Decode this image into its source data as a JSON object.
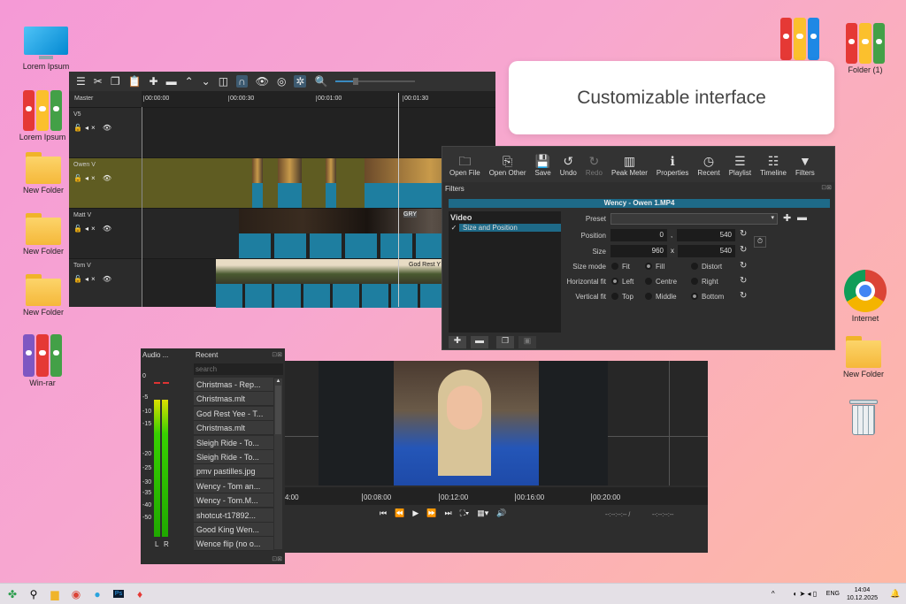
{
  "desktop": {
    "left_icons": [
      {
        "label": "Lorem Ipsum",
        "icon": "monitor-icon"
      },
      {
        "label": "Lorem Ipsum",
        "icon": "binders-icon"
      },
      {
        "label": "New Folder",
        "icon": "folder-icon"
      },
      {
        "label": "New Folder",
        "icon": "folder-icon"
      },
      {
        "label": "New Folder",
        "icon": "folder-icon"
      },
      {
        "label": "Win-rar",
        "icon": "winrar-icon"
      }
    ],
    "right_icons": [
      {
        "label": "Folder (1)",
        "icon": "binders-icon"
      },
      {
        "label": "Internet",
        "icon": "chrome-icon"
      },
      {
        "label": "New Folder",
        "icon": "folder-icon"
      }
    ],
    "card_title": "Customizable interface"
  },
  "timeline": {
    "master": "Master",
    "ruler": [
      "00:00:00",
      "00:00:30",
      "00:01:00",
      "00:01:30"
    ],
    "tracks": [
      {
        "name": "V5"
      },
      {
        "name": "Owen V"
      },
      {
        "name": "Matt V"
      },
      {
        "name": "Tom V"
      }
    ],
    "clip_titles": {
      "matt": "GRY",
      "tom": "God Rest Y"
    }
  },
  "toolbar": {
    "buttons": [
      {
        "label": "Open File",
        "icon": "folder-open-icon"
      },
      {
        "label": "Open Other",
        "icon": "open-other-icon"
      },
      {
        "label": "Save",
        "icon": "save-icon"
      },
      {
        "label": "Undo",
        "icon": "undo-icon"
      },
      {
        "label": "Redo",
        "icon": "redo-icon"
      },
      {
        "label": "Peak Meter",
        "icon": "peak-meter-icon"
      },
      {
        "label": "Properties",
        "icon": "info-icon"
      },
      {
        "label": "Recent",
        "icon": "clock-icon"
      },
      {
        "label": "Playlist",
        "icon": "list-icon"
      },
      {
        "label": "Timeline",
        "icon": "timeline-icon"
      },
      {
        "label": "Filters",
        "icon": "filter-icon"
      }
    ]
  },
  "filters": {
    "panel_title": "Filters",
    "clip": "Wency - Owen 1.MP4",
    "category": "Video",
    "item": "Size and Position",
    "preset_label": "Preset",
    "position_label": "Position",
    "pos_x": "0",
    "pos_sep": ",",
    "pos_y": "540",
    "size_label": "Size",
    "size_w": "960",
    "size_sep": "x",
    "size_h": "540",
    "size_mode_label": "Size mode",
    "size_mode": [
      "Fit",
      "Fill",
      "Distort"
    ],
    "hfit_label": "Horizontal fit",
    "hfit": [
      "Left",
      "Centre",
      "Right"
    ],
    "vfit_label": "Vertical fit",
    "vfit": [
      "Top",
      "Middle",
      "Bottom"
    ]
  },
  "audio": {
    "title": "Audio ...",
    "scale": [
      "0",
      "-5",
      "-10",
      "-15",
      "-20",
      "-25",
      "-30",
      "-35",
      "-40",
      "-50"
    ],
    "channels": [
      "L",
      "R"
    ]
  },
  "recent": {
    "title": "Recent",
    "search_placeholder": "search",
    "items": [
      "Christmas - Rep...",
      "Christmas.mlt",
      "God Rest Yee - T...",
      "Christmas.mlt",
      "Sleigh Ride - To...",
      "Sleigh Ride - To...",
      "pmv pastilles.jpg",
      "Wency - Tom an...",
      "Wency - Tom.M...",
      "shotcut-t17892...",
      "Good King Wen...",
      "Wence flip (no o..."
    ]
  },
  "player": {
    "ruler": [
      "4:00",
      "00:08:00",
      "00:12:00",
      "00:16:00",
      "00:20:00"
    ],
    "timecode": "--:--:--:-- /",
    "duration": "--:--:--:--"
  },
  "taskbar": {
    "lang": "ENG",
    "time": "14:04",
    "date": "10.12.2025"
  }
}
